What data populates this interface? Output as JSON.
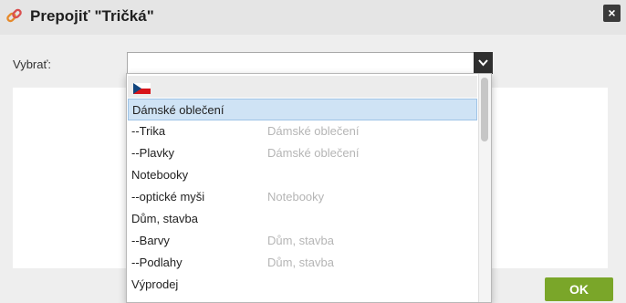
{
  "dialog": {
    "title": "Prepojiť \"Tričká\"",
    "close_label": "×"
  },
  "form": {
    "select_label": "Vybrať:",
    "selected_value": ""
  },
  "dropdown": {
    "flag_option": "czech-flag-icon",
    "options": [
      {
        "name": "Dámské oblečení",
        "parent": ""
      },
      {
        "name": "--Trika",
        "parent": "Dámské oblečení"
      },
      {
        "name": "--Plavky",
        "parent": "Dámské oblečení"
      },
      {
        "name": "Notebooky",
        "parent": ""
      },
      {
        "name": "--optické myši",
        "parent": "Notebooky"
      },
      {
        "name": "Dům, stavba",
        "parent": ""
      },
      {
        "name": "--Barvy",
        "parent": "Dům, stavba"
      },
      {
        "name": "--Podlahy",
        "parent": "Dům, stavba"
      },
      {
        "name": "Výprodej",
        "parent": ""
      }
    ],
    "highlighted_index": 0
  },
  "footer": {
    "ok_label": "OK"
  },
  "colors": {
    "ok_button": "#7aa629",
    "highlight": "#cfe3f5"
  }
}
